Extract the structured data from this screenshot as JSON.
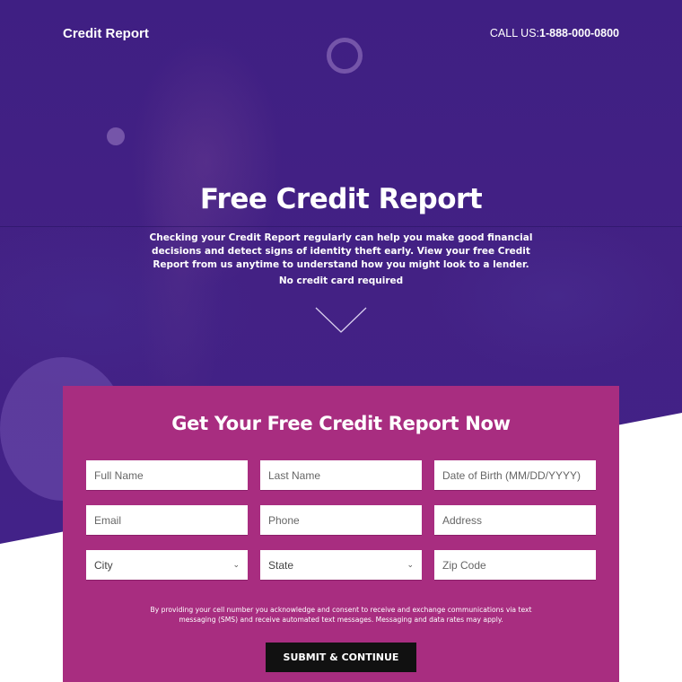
{
  "header": {
    "brand": "Credit Report",
    "call_label": "CALL US:",
    "phone": "1-888-000-0800"
  },
  "hero": {
    "title": "Free Credit Report",
    "description": "Checking your Credit Report regularly can help you make good financial decisions and detect signs of identity theft early. View your free Credit Report from us anytime to understand how you might look to a lender.",
    "note": "No credit card required",
    "scroll_icon": "chevron-down-icon"
  },
  "form": {
    "title": "Get Your Free Credit Report Now",
    "fields": {
      "full_name": {
        "placeholder": "Full Name",
        "value": ""
      },
      "last_name": {
        "placeholder": "Last Name",
        "value": ""
      },
      "dob": {
        "placeholder": "Date of Birth (MM/DD/YYYY)",
        "value": ""
      },
      "email": {
        "placeholder": "Email",
        "value": ""
      },
      "phone": {
        "placeholder": "Phone",
        "value": ""
      },
      "address": {
        "placeholder": "Address",
        "value": ""
      },
      "city": {
        "selected": "City"
      },
      "state": {
        "selected": "State"
      },
      "zip": {
        "placeholder": "Zip Code",
        "value": ""
      }
    },
    "consent": "By providing your cell number you acknowledge and consent to receive and exchange communications via text messaging (SMS) and receive automated text messages. Messaging and data rates may apply.",
    "submit_label": "SUBMIT & CONTINUE"
  },
  "colors": {
    "hero_bg": "#41228a",
    "form_bg": "#a82d80",
    "button_bg": "#111111"
  }
}
